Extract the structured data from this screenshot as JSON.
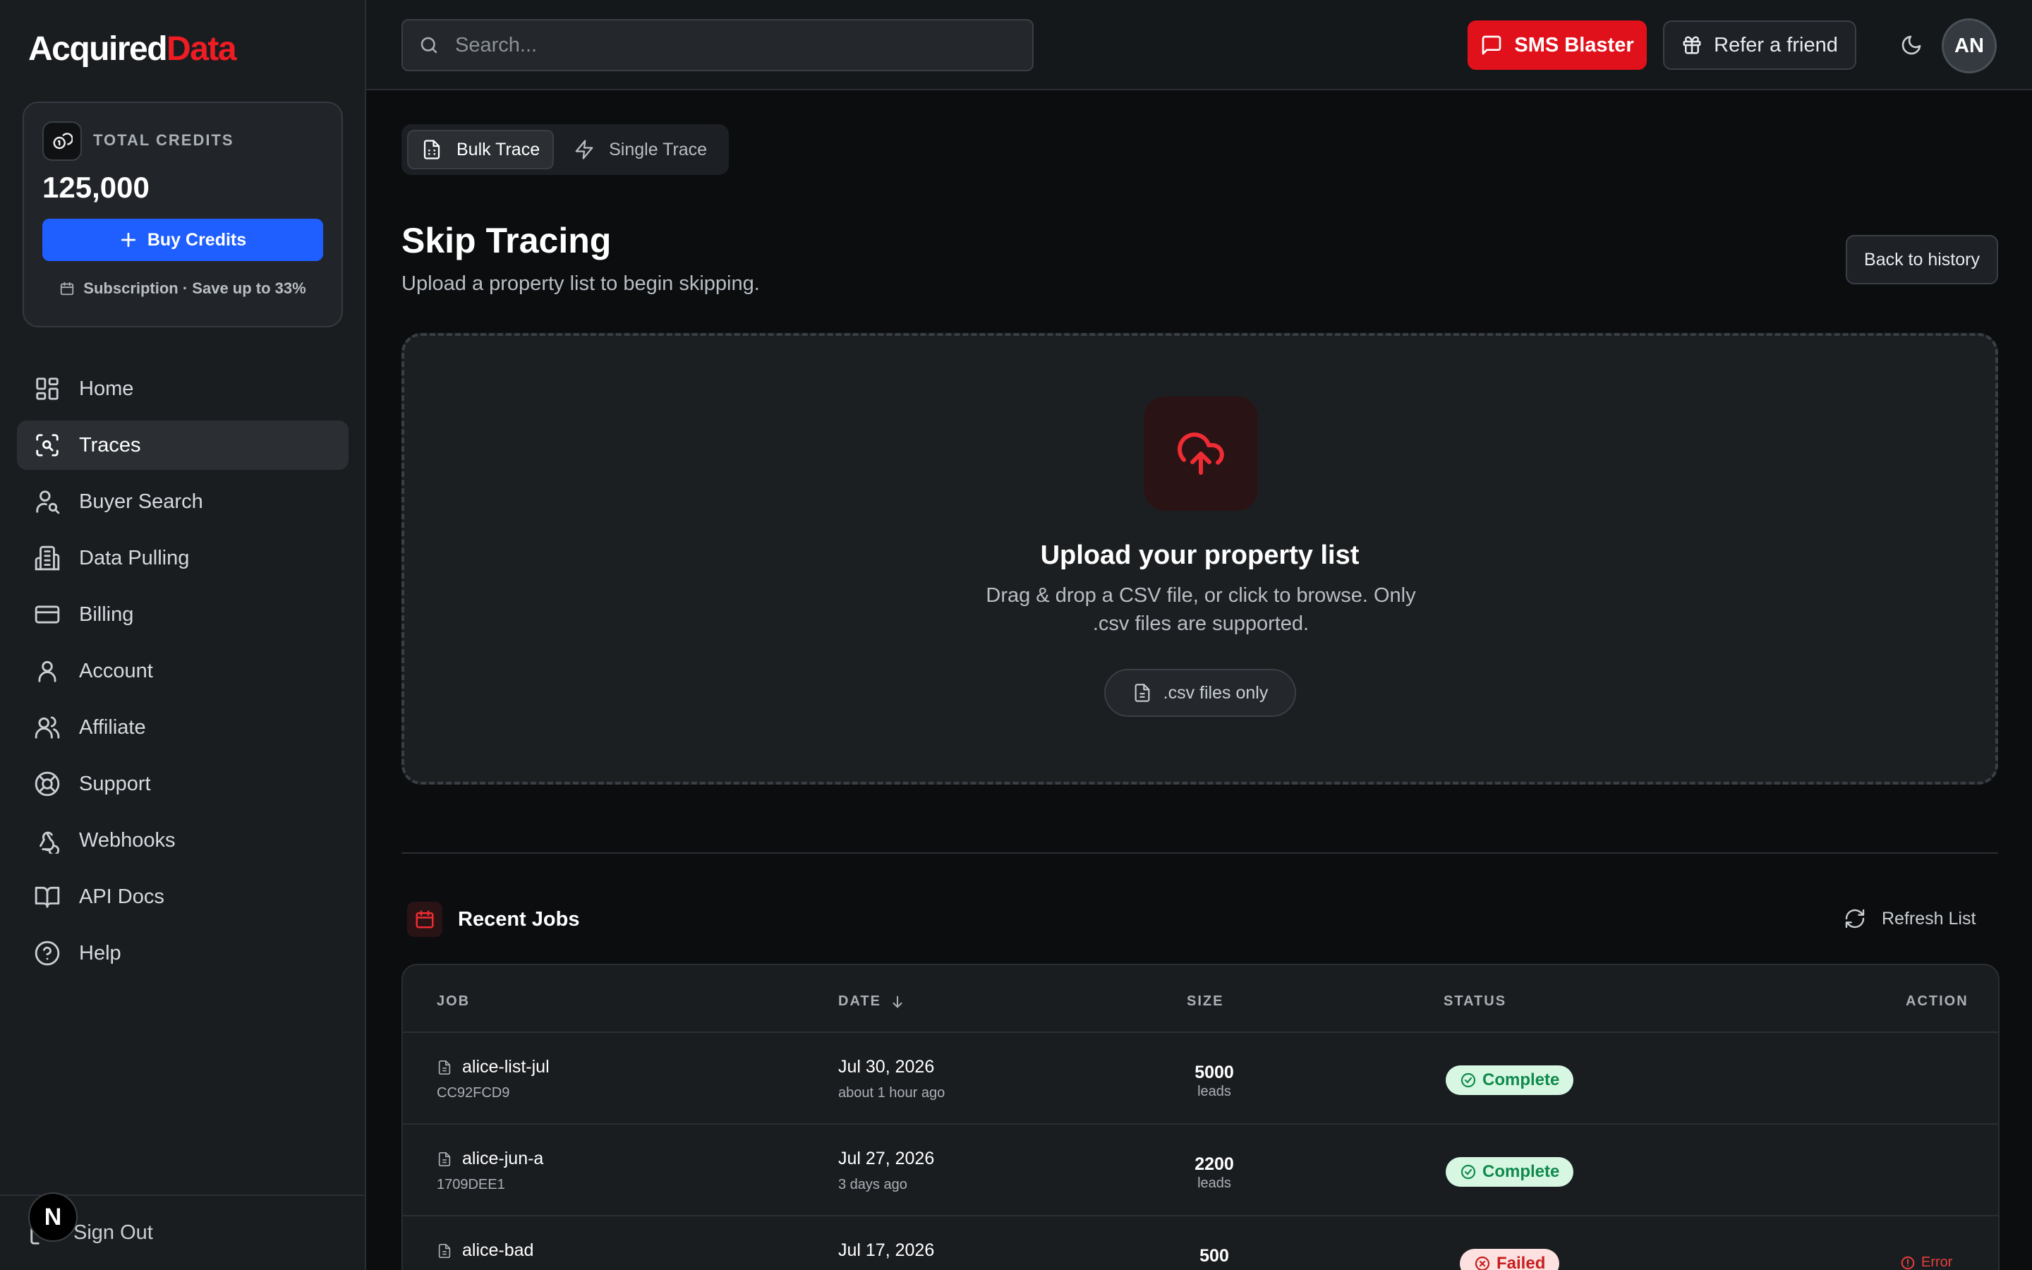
{
  "brand": {
    "part1": "Acquired",
    "part2": "Data"
  },
  "credits": {
    "label": "TOTAL CREDITS",
    "value": "125,000",
    "buy_label": "Buy Credits",
    "subscription": "Subscription · Save up to 33%"
  },
  "nav": [
    {
      "label": "Home",
      "icon": "grid-icon"
    },
    {
      "label": "Traces",
      "icon": "scan-icon",
      "active": true
    },
    {
      "label": "Buyer Search",
      "icon": "user-search-icon"
    },
    {
      "label": "Data Pulling",
      "icon": "building-icon"
    },
    {
      "label": "Billing",
      "icon": "credit-card-icon"
    },
    {
      "label": "Account",
      "icon": "user-icon"
    },
    {
      "label": "Affiliate",
      "icon": "users-icon"
    },
    {
      "label": "Support",
      "icon": "lifebuoy-icon"
    },
    {
      "label": "Webhooks",
      "icon": "webhook-icon"
    },
    {
      "label": "API Docs",
      "icon": "book-icon"
    },
    {
      "label": "Help",
      "icon": "help-circle-icon"
    }
  ],
  "signout": "Sign Out",
  "n_badge": "N",
  "topbar": {
    "search_placeholder": "Search...",
    "sms_label": "SMS Blaster",
    "refer_label": "Refer a friend",
    "avatar": "AN"
  },
  "tabs": [
    {
      "label": "Bulk Trace",
      "active": true
    },
    {
      "label": "Single Trace"
    }
  ],
  "page": {
    "title": "Skip Tracing",
    "subtitle": "Upload a property list to begin skipping.",
    "back_label": "Back to history"
  },
  "upload": {
    "title": "Upload your property list",
    "description": "Drag & drop a CSV file, or click to browse. Only .csv files are supported.",
    "chip": ".csv files only"
  },
  "recent": {
    "title": "Recent Jobs",
    "refresh_label": "Refresh List",
    "columns": {
      "job": "JOB",
      "date": "DATE",
      "size": "SIZE",
      "status": "STATUS",
      "action": "ACTION"
    },
    "rows": [
      {
        "name": "alice-list-jul",
        "id": "CC92FCD9",
        "date": "Jul 30, 2026",
        "relative": "about 1 hour ago",
        "size": "5000",
        "unit": "leads",
        "status": "Complete"
      },
      {
        "name": "alice-jun-a",
        "id": "1709DEE1",
        "date": "Jul 27, 2026",
        "relative": "3 days ago",
        "size": "2200",
        "unit": "leads",
        "status": "Complete"
      },
      {
        "name": "alice-bad",
        "id": "",
        "date": "Jul 17, 2026",
        "relative": "",
        "size": "500",
        "unit": "",
        "status": "Failed",
        "action": "Error"
      }
    ]
  },
  "colors": {
    "accent_red": "#ef1c24",
    "primary_blue": "#1f5fff",
    "background": "#0b0d0f",
    "sidebar": "#1a1d20"
  }
}
